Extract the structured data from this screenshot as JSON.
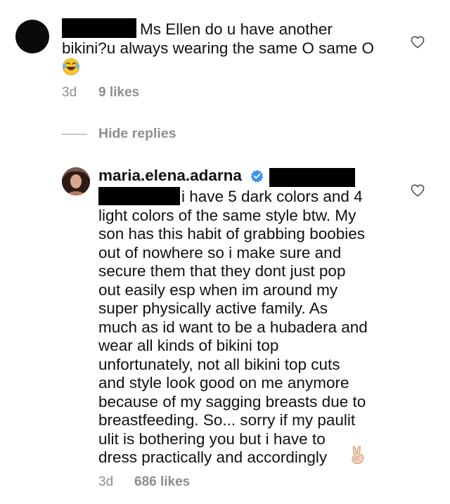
{
  "comment": {
    "text_line1": "Ms Ellen do u have another",
    "text_line2": "bikini?u always wearing the same O same O",
    "emoji": "laughing-tears-emoji",
    "time": "3d",
    "likes": "9 likes"
  },
  "replies_toggle": {
    "label": "Hide replies"
  },
  "reply": {
    "username": "maria.elena.adarna",
    "verified_color": "#3897f0",
    "lines": [
      "i have 5 dark colors and 4",
      "light colors of the same style btw. My",
      "son has this habit of grabbing boobies",
      "out of nowhere so i make sure and",
      "secure them that they dont just pop",
      "out easily esp when im around my",
      "super physically active family. As",
      "much as id want to be a hubadera and",
      "wear all kinds of bikini top",
      "unfortunately, not all bikini top cuts",
      "and style look good on me anymore",
      "because of my sagging breasts due to",
      "breastfeeding. So... sorry if my paulit",
      "ulit is bothering you but i have to",
      "dress practically and accordingly"
    ],
    "emoji": "victory-hand-emoji",
    "time": "3d",
    "likes": "686 likes"
  },
  "colors": {
    "text": "#111111",
    "meta": "#8e8e8e",
    "redaction": "#000000"
  }
}
